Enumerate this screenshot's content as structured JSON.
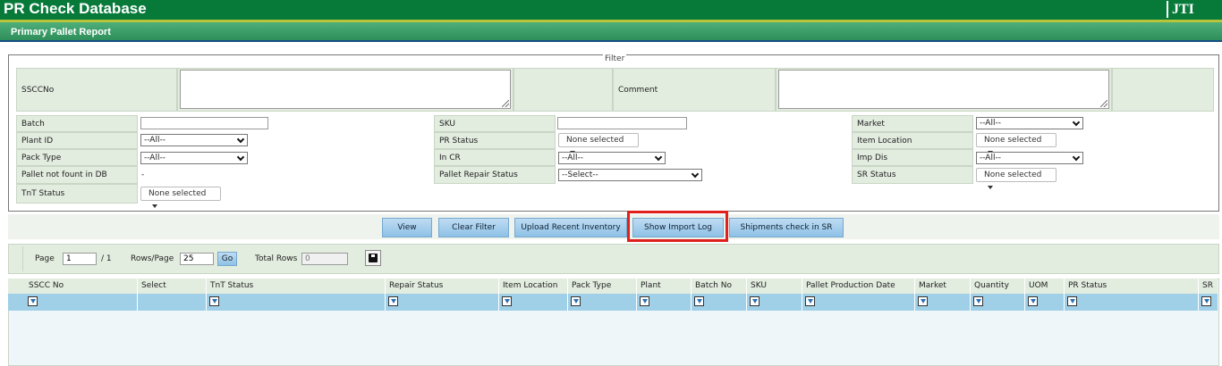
{
  "app": {
    "title": "PR Check Database",
    "logo": "JTI"
  },
  "page": {
    "title": "Primary Pallet Report"
  },
  "filter": {
    "legend": "Filter",
    "sscc_label": "SSCCNo",
    "comment_label": "Comment",
    "batch_label": "Batch",
    "sku_label": "SKU",
    "market_label": "Market",
    "market_value": "--All--",
    "plant_label": "Plant ID",
    "plant_value": "--All--",
    "pr_status_label": "PR Status",
    "pr_status_value": "None selected",
    "item_location_label": "Item Location",
    "item_location_value": "None selected",
    "pack_type_label": "Pack Type",
    "pack_type_value": "--All--",
    "in_cr_label": "In CR",
    "in_cr_value": "--All--",
    "imp_dis_label": "Imp Dis",
    "imp_dis_value": "--All--",
    "pallet_not_found_label": "Pallet not fount in DB",
    "pallet_not_found_value": "-",
    "repair_status_label": "Pallet Repair Status",
    "repair_status_value": "--Select--",
    "sr_status_label": "SR Status",
    "sr_status_value": "None selected",
    "tnt_status_label": "TnT Status",
    "tnt_status_value": "None selected"
  },
  "actions": {
    "view": "View",
    "clear_filter": "Clear Filter",
    "upload_inventory": "Upload Recent Inventory",
    "show_import_log": "Show Import Log",
    "shipments_check": "Shipments check in SR"
  },
  "pager": {
    "page_label": "Page",
    "page_value": "1",
    "page_total": "/ 1",
    "rows_label": "Rows/Page",
    "rows_value": "25",
    "go": "Go",
    "total_label": "Total Rows",
    "total_value": "0"
  },
  "grid": {
    "columns": [
      "SSCC No",
      "Select",
      "TnT Status",
      "Repair Status",
      "Item Location",
      "Pack Type",
      "Plant",
      "Batch No",
      "SKU",
      "Pallet Production Date",
      "Market",
      "Quantity",
      "UOM",
      "PR Status",
      "SR"
    ]
  },
  "icons": {
    "save": "save-icon",
    "filter": "filter-icon",
    "dropdown": "chevron-down-icon"
  },
  "colors": {
    "header_green": "#077a3a",
    "highlight_red": "#e0201d",
    "button_blue": "#8ec1e6"
  }
}
